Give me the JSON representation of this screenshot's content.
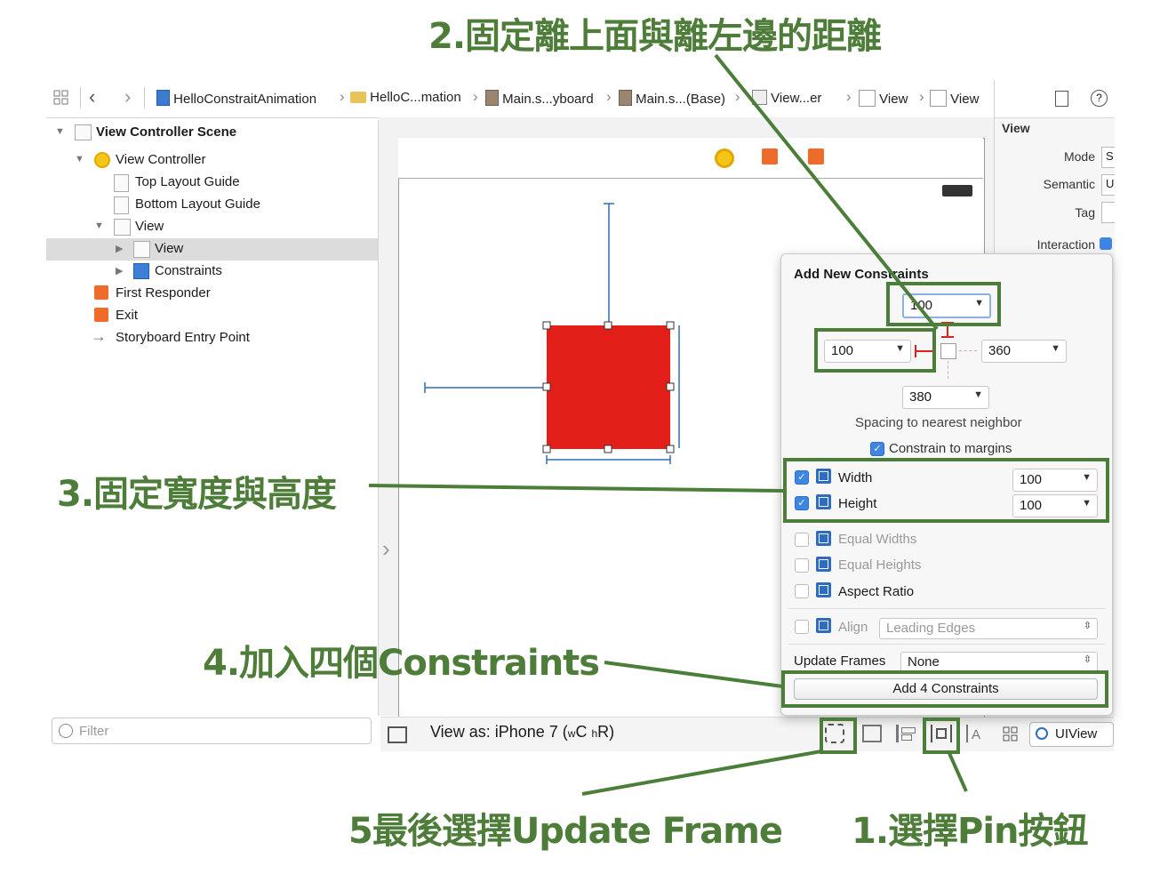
{
  "annotations": {
    "step2": "2.固定離上面與離左邊的距離",
    "step3": "3.固定寬度與高度",
    "step4": "4.加入四個Constraints",
    "step5": "5最後選擇Update Frame",
    "step1": "1.選擇Pin按鈕"
  },
  "jumpbar": {
    "crumbs": [
      "HelloConstraitAnimation",
      "HelloC...mation",
      "Main.s...yboard",
      "Main.s...(Base)",
      "View...er",
      "View",
      "View"
    ]
  },
  "outline": {
    "items": [
      {
        "label": "View Controller Scene"
      },
      {
        "label": "View Controller"
      },
      {
        "label": "Top Layout Guide"
      },
      {
        "label": "Bottom Layout Guide"
      },
      {
        "label": "View"
      },
      {
        "label": "View"
      },
      {
        "label": "Constraints"
      },
      {
        "label": "First Responder"
      },
      {
        "label": "Exit"
      },
      {
        "label": "Storyboard Entry Point"
      }
    ],
    "filter_placeholder": "Filter"
  },
  "canvas": {
    "view_as": "View as: iPhone 7 (",
    "size_class_w": "w",
    "size_class_c": "C",
    "size_class_h": "h",
    "size_class_r": "R)",
    "class_label": "UIView"
  },
  "inspector": {
    "section": "View",
    "rows": [
      "Mode",
      "Semantic",
      "Tag",
      "Interaction"
    ],
    "mode_value": "S",
    "semantic_value": "U"
  },
  "popover": {
    "title": "Add New Constraints",
    "top": "100",
    "left": "100",
    "right": "360",
    "bottom": "380",
    "spacing_label": "Spacing to nearest neighbor",
    "constrain_margins": "Constrain to margins",
    "width_label": "Width",
    "width_value": "100",
    "height_label": "Height",
    "height_value": "100",
    "equal_widths": "Equal Widths",
    "equal_heights": "Equal Heights",
    "aspect_ratio": "Aspect Ratio",
    "align_label": "Align",
    "align_value": "Leading Edges",
    "update_frames_label": "Update Frames",
    "update_frames_value": "None",
    "add_button": "Add 4 Constraints"
  },
  "colors": {
    "annotation_green": "#4e7d3a",
    "red_view": "#e31f1a",
    "accent_blue": "#3f86e4"
  }
}
